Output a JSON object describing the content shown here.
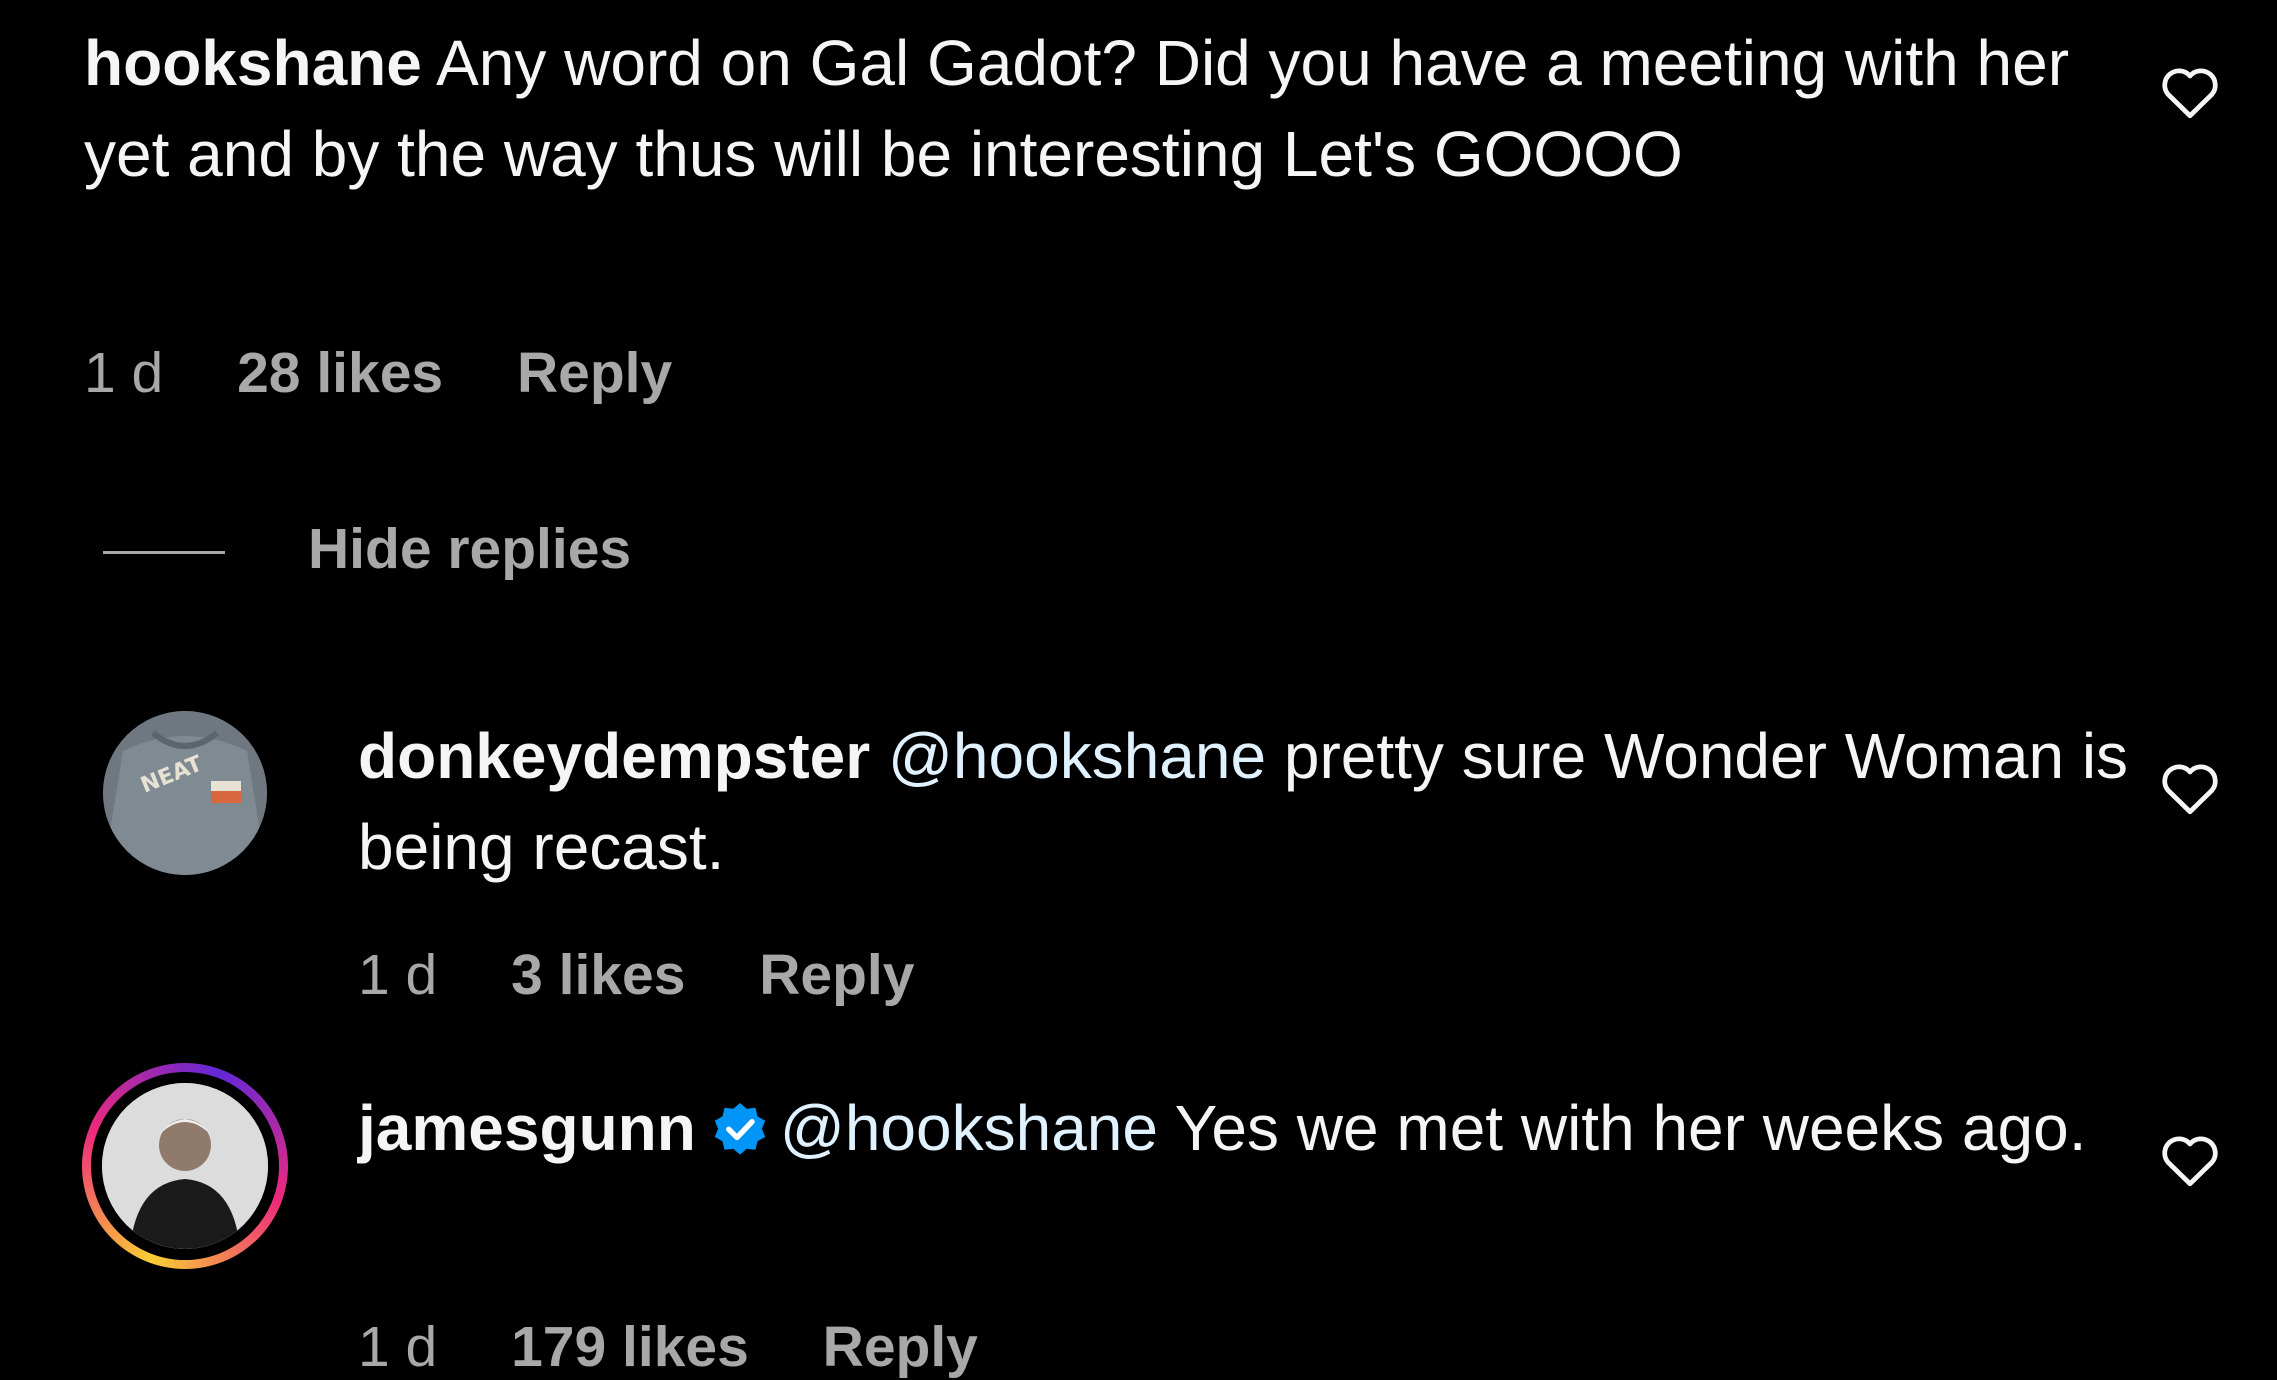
{
  "comments": [
    {
      "username": "hookshane",
      "text": "Any word on Gal Gadot? Did you have a meeting with her yet and by the way thus will be interesting Let's GOOOO",
      "age": "1 d",
      "likes": "28 likes",
      "reply_label": "Reply",
      "like_icon": "heart-outline-icon"
    }
  ],
  "replies_toggle": {
    "label": "Hide replies"
  },
  "replies": [
    {
      "username": "donkeydempster",
      "mention": "@hookshane",
      "text": "pretty sure Wonder Woman is being recast.",
      "age": "1 d",
      "likes": "3 likes",
      "reply_label": "Reply",
      "avatar_icon": "avatar-shirt-neat",
      "avatar_text": "NEAT",
      "like_icon": "heart-outline-icon"
    },
    {
      "username": "jamesgunn",
      "verified": true,
      "mention": "@hookshane",
      "text": "Yes we met with her weeks ago.",
      "age": "1 d",
      "likes": "179 likes",
      "reply_label": "Reply",
      "avatar_icon": "avatar-photo-story-ring",
      "like_icon": "heart-outline-icon"
    }
  ],
  "colors": {
    "background": "#000000",
    "text": "#f5f5f5",
    "secondary": "#a8a8a8",
    "mention": "#e0f1ff",
    "verified": "#0095f6",
    "story_ring_start": "#f9ce34",
    "story_ring_mid": "#ee2a7b",
    "story_ring_end": "#6228d7"
  }
}
